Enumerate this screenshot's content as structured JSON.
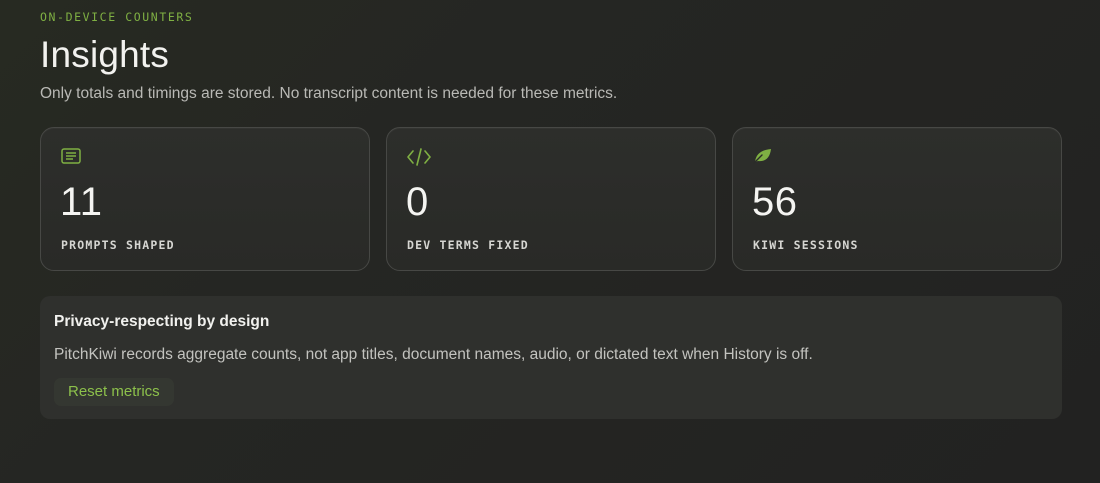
{
  "header": {
    "eyebrow": "ON-DEVICE COUNTERS",
    "title": "Insights",
    "subtitle": "Only totals and timings are stored. No transcript content is needed for these metrics."
  },
  "metrics": [
    {
      "icon": "document-lines-icon",
      "value": "11",
      "label": "PROMPTS SHAPED"
    },
    {
      "icon": "code-icon",
      "value": "0",
      "label": "DEV TERMS FIXED"
    },
    {
      "icon": "leaf-icon",
      "value": "56",
      "label": "KIWI SESSIONS"
    }
  ],
  "privacy": {
    "heading": "Privacy-respecting by design",
    "body": "PitchKiwi records aggregate counts, not app titles, document names, audio, or dictated text when History is off.",
    "reset_label": "Reset metrics"
  },
  "colors": {
    "accent": "#7fb043",
    "background": "#252623",
    "card_border": "#474845"
  }
}
